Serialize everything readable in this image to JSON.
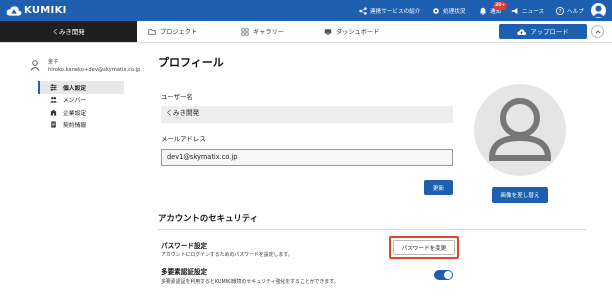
{
  "colors": {
    "brand": "#1e5fb0",
    "dark": "#1f1f1f",
    "highlight": "#e0462b",
    "badge": "#e53935"
  },
  "topbar": {
    "logo_text": "KUMIKI",
    "link_services": "連携サービスの紹介",
    "processing_status": "処理状況",
    "notifications": "通知",
    "notification_badge": "20+",
    "news": "ニュース",
    "help": "ヘルプ"
  },
  "subbar": {
    "org_name": "くみき開発",
    "nav": {
      "project": "プロジェクト",
      "gallery": "ギャラリー",
      "dashboard": "ダッシュボード"
    },
    "upload_label": "アップロード"
  },
  "sidebar": {
    "user_name": "金子",
    "user_email": "hiroko.kaneko+dev@skymatix.co.jp",
    "items": [
      {
        "label": "個人設定",
        "icon": "sliders-icon",
        "active": true
      },
      {
        "label": "メンバー",
        "icon": "users-icon",
        "active": false
      },
      {
        "label": "企業設定",
        "icon": "building-icon",
        "active": false
      },
      {
        "label": "契約情報",
        "icon": "document-icon",
        "active": false
      }
    ]
  },
  "profile": {
    "title": "プロフィール",
    "username_label": "ユーザー名",
    "username_value": "くみき開発",
    "email_label": "メールアドレス",
    "email_value": "dev1@skymatix.co.jp",
    "update_label": "更新",
    "change_image_label": "画像を差し替え"
  },
  "security": {
    "title": "アカウントのセキュリティ",
    "password_title": "パスワード設定",
    "password_desc": "アカウントにログインするためのパスワードを設定します。",
    "password_button": "パスワードを変更",
    "mfa_title": "多要素認証設定",
    "mfa_desc": "多要素認証を利用するとKUMIKI環境のセキュリティ強化をすることができます。",
    "mfa_enabled": true
  }
}
